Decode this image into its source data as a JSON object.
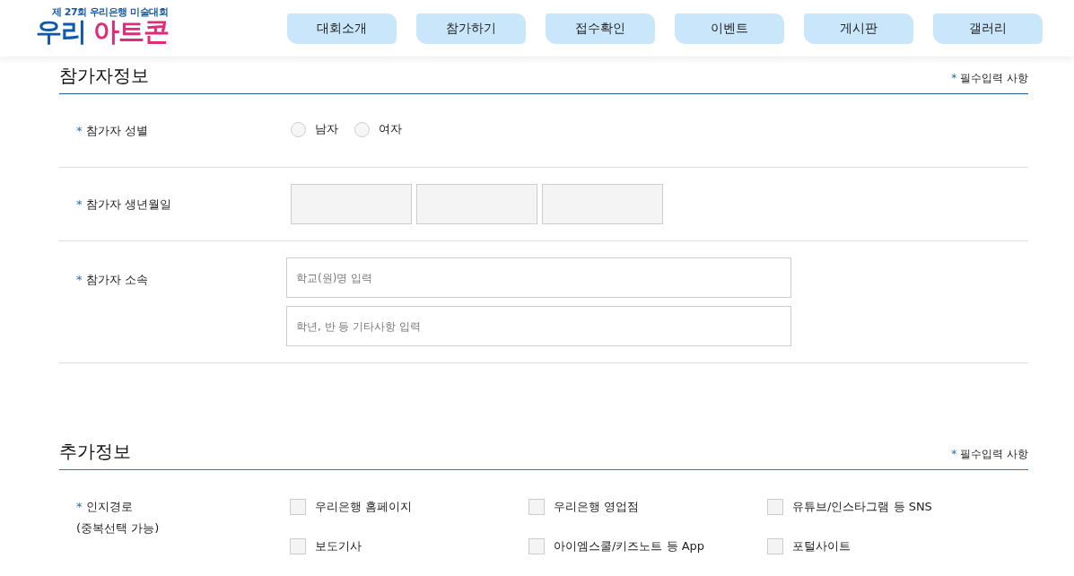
{
  "header": {
    "logo_subtitle": "제 27회 우리은행 미술대회",
    "logo_word_1": "우리",
    "logo_word_2": "아트콘"
  },
  "nav": [
    {
      "label": "대회소개"
    },
    {
      "label": "참가하기"
    },
    {
      "label": "접수확인"
    },
    {
      "label": "이벤트"
    },
    {
      "label": "게시판"
    },
    {
      "label": "갤러리"
    }
  ],
  "sections": [
    {
      "title": "참가자정보",
      "required_mark": "*",
      "required_note": "필수입력 사항",
      "rows": [
        {
          "kind": "radio",
          "mark": "*",
          "label": "참가자 성별",
          "options": [
            {
              "label": "남자",
              "selected": false
            },
            {
              "label": "여자",
              "selected": false
            }
          ]
        },
        {
          "kind": "boxes",
          "mark": "*",
          "label": "참가자 생년월일",
          "fields": [
            {
              "kind": "box"
            },
            {
              "kind": "box"
            },
            {
              "kind": "box"
            }
          ]
        },
        {
          "kind": "text",
          "mark": "*",
          "label": "참가자 소속",
          "fields": [
            {
              "placeholder": "학교(원)명 입력"
            },
            {
              "placeholder": "학년, 반 등 기타사항 입력"
            }
          ]
        }
      ]
    },
    {
      "title": "추가정보",
      "required_mark": "*",
      "required_note": "필수입력 사항",
      "rows": [
        {
          "kind": "checks",
          "mark": "*",
          "label": "인지경로",
          "sublabel": "(중복선택 가능)",
          "options": [
            {
              "label": "우리은행 홈페이지",
              "checked": false
            },
            {
              "label": "우리은행 영업점",
              "checked": false
            },
            {
              "label": "유튜브/인스타그램 등 SNS",
              "checked": false
            },
            {
              "label": "보도기사",
              "checked": false
            },
            {
              "label": "아이엠스쿨/키즈노트 등 App",
              "checked": false
            },
            {
              "label": "포털사이트",
              "checked": false
            }
          ]
        }
      ]
    }
  ]
}
